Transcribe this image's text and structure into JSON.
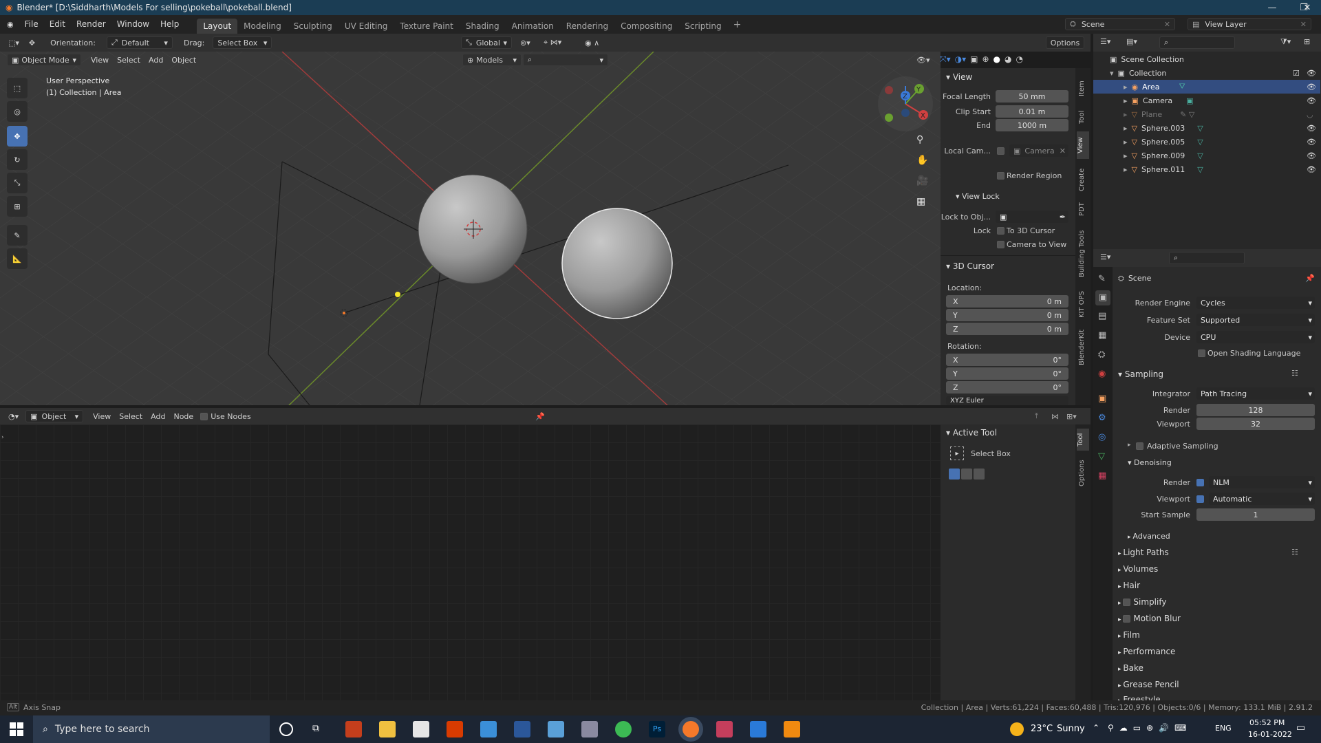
{
  "window": {
    "title": "Blender* [D:\\Siddharth\\Models For selling\\pokeball\\pokeball.blend]"
  },
  "menu": [
    "File",
    "Edit",
    "Render",
    "Window",
    "Help"
  ],
  "workspaces": [
    "Layout",
    "Modeling",
    "Sculpting",
    "UV Editing",
    "Texture Paint",
    "Shading",
    "Animation",
    "Rendering",
    "Compositing",
    "Scripting"
  ],
  "top_right": {
    "scene": "Scene",
    "view_layer": "View Layer"
  },
  "viewport_header": {
    "orientation_label": "Orientation:",
    "orientation_value": "Default",
    "drag_label": "Drag:",
    "drag_value": "Select Box",
    "transform": "Global",
    "options": "Options",
    "mode": "Object Mode",
    "menus": [
      "View",
      "Select",
      "Add",
      "Object"
    ],
    "models": "Models"
  },
  "viewport_overlay": {
    "line1": "User Perspective",
    "line2": "(1) Collection | Area"
  },
  "npanel_tabs": [
    "Item",
    "Tool",
    "View",
    "Create",
    "PDT",
    "Building Tools",
    "KIT OPS",
    "BlenderKit"
  ],
  "view_panel": {
    "title": "View",
    "focal_length_label": "Focal Length",
    "focal_length": "50 mm",
    "clip_start_label": "Clip Start",
    "clip_start": "0.01 m",
    "end_label": "End",
    "end": "1000 m",
    "local_cam_label": "Local Cam...",
    "local_cam_value": "Camera",
    "render_region": "Render Region",
    "view_lock_title": "View Lock",
    "lock_to_obj_label": "Lock to Obj...",
    "lock_label": "Lock",
    "to_3d_cursor": "To 3D Cursor",
    "camera_to_view": "Camera to View"
  },
  "cursor_panel": {
    "title": "3D Cursor",
    "location_label": "Location:",
    "loc": [
      {
        "axis": "X",
        "value": "0 m"
      },
      {
        "axis": "Y",
        "value": "0 m"
      },
      {
        "axis": "Z",
        "value": "0 m"
      }
    ],
    "rotation_label": "Rotation:",
    "rot": [
      {
        "axis": "X",
        "value": "0°"
      },
      {
        "axis": "Y",
        "value": "0°"
      },
      {
        "axis": "Z",
        "value": "0°"
      }
    ],
    "euler": "XYZ Euler"
  },
  "node_header": {
    "type": "Object",
    "menus": [
      "View",
      "Select",
      "Add",
      "Node"
    ],
    "use_nodes": "Use Nodes"
  },
  "node_tabs": [
    "Tool",
    "Options"
  ],
  "active_tool": {
    "title": "Active Tool",
    "tool": "Select Box"
  },
  "outliner": {
    "root": "Scene Collection",
    "collection": "Collection",
    "items": [
      "Area",
      "Camera",
      "Plane",
      "Sphere.003",
      "Sphere.005",
      "Sphere.009",
      "Sphere.011"
    ]
  },
  "properties": {
    "context": "Scene",
    "render_engine_label": "Render Engine",
    "render_engine": "Cycles",
    "feature_set_label": "Feature Set",
    "feature_set": "Supported",
    "device_label": "Device",
    "device": "CPU",
    "osl": "Open Shading Language",
    "sampling": "Sampling",
    "integrator_label": "Integrator",
    "integrator": "Path Tracing",
    "render_label": "Render",
    "render_samples": "128",
    "viewport_label": "Viewport",
    "viewport_samples": "32",
    "adaptive": "Adaptive Sampling",
    "denoising": "Denoising",
    "den_render_label": "Render",
    "den_render": "NLM",
    "den_viewport_label": "Viewport",
    "den_viewport": "Automatic",
    "start_sample_label": "Start Sample",
    "start_sample": "1",
    "advanced": "Advanced",
    "sections": [
      "Light Paths",
      "Volumes",
      "Hair",
      "Simplify",
      "Motion Blur",
      "Film",
      "Performance",
      "Bake",
      "Grease Pencil",
      "Freestyle"
    ]
  },
  "statusbar": {
    "left_key": "Alt",
    "left": "Axis Snap",
    "right": "Collection | Area | Verts:61,224 | Faces:60,488 | Tris:120,976 | Objects:0/6 | Memory: 133.1 MiB | 2.91.2"
  },
  "taskbar": {
    "search_placeholder": "Type here to search",
    "weather_temp": "23°C",
    "weather_text": "Sunny",
    "lang": "ENG",
    "time": "05:52 PM",
    "date": "16-01-2022"
  }
}
